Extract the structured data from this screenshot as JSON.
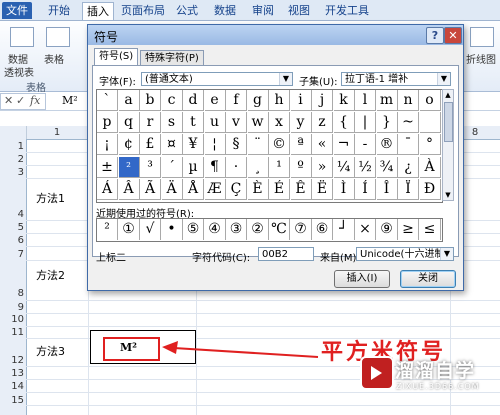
{
  "ribbon": {
    "tabs": [
      "文件",
      "开始",
      "插入",
      "页面布局",
      "公式",
      "数据",
      "审阅",
      "视图",
      "开发工具"
    ],
    "active_tab": "插入",
    "left_items": [
      "数据",
      "表格",
      "透视表"
    ],
    "group_label": "表格",
    "right_item": "折线图"
  },
  "formula_bar": {
    "fx": "fx",
    "content": "M²"
  },
  "grid": {
    "columns": [
      "1",
      "8"
    ],
    "rows": [
      "1",
      "2",
      "3",
      "4",
      "5",
      "6",
      "7",
      "8",
      "9",
      "10",
      "11",
      "12",
      "13",
      "14",
      "15"
    ],
    "method1": "方法1",
    "method2": "方法2",
    "method3": "方法3",
    "c12_value": "M²"
  },
  "annotation": "平方米符号",
  "watermark": {
    "title": "溜溜自学",
    "url": "ZIXUE.3D66.COM"
  },
  "dialog": {
    "title": "符号",
    "help": "?",
    "close_x": "✕",
    "tabs": [
      "符号(S)",
      "特殊字符(P)"
    ],
    "font_label": "字体(F):",
    "font_value": "(普通文本)",
    "subset_label": "子集(U):",
    "subset_value": "拉丁语-1 增补",
    "symbols": [
      [
        "`",
        "a",
        "b",
        "c",
        "d",
        "e",
        "f",
        "g",
        "h",
        "i",
        "j",
        "k",
        "l",
        "m",
        "n",
        "o"
      ],
      [
        "p",
        "q",
        "r",
        "s",
        "t",
        "u",
        "v",
        "w",
        "x",
        "y",
        "z",
        "{",
        "|",
        "}",
        "~",
        ""
      ],
      [
        "¡",
        "¢",
        "£",
        "¤",
        "¥",
        "¦",
        "§",
        "¨",
        "©",
        "ª",
        "«",
        "¬",
        "-",
        "®",
        "¯",
        "°"
      ],
      [
        "±",
        "²",
        "³",
        "´",
        "µ",
        "¶",
        "·",
        "¸",
        "¹",
        "º",
        "»",
        "¼",
        "½",
        "¾",
        "¿",
        "À"
      ],
      [
        "Á",
        "Â",
        "Ã",
        "Ä",
        "Å",
        "Æ",
        "Ç",
        "È",
        "É",
        "Ê",
        "Ë",
        "Ì",
        "Í",
        "Î",
        "Ï",
        "Ð"
      ]
    ],
    "recent_label": "近期使用过的符号(R):",
    "recent": [
      "²",
      "①",
      "√",
      "•",
      "⑤",
      "④",
      "③",
      "②",
      "℃",
      "⑦",
      "⑥",
      "┘",
      "×",
      "⑨",
      "≥",
      "≤"
    ],
    "char_name": "上标二",
    "charcode_label": "字符代码(C):",
    "charcode_value": "00B2",
    "from_label": "来自(M):",
    "from_value": "Unicode(十六进制)",
    "insert_button": "插入(I)",
    "close_button": "关闭"
  }
}
